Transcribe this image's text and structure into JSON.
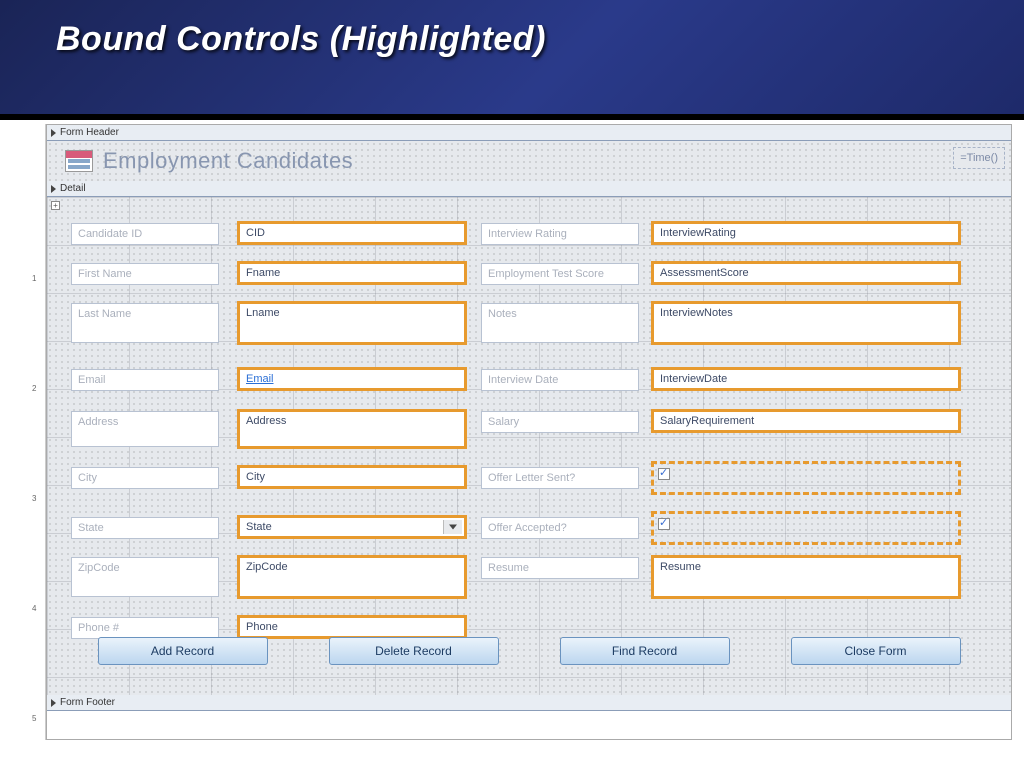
{
  "slide": {
    "title": "Bound Controls (Highlighted)"
  },
  "sections": {
    "header": "Form Header",
    "detail": "Detail",
    "footer": "Form Footer"
  },
  "form": {
    "title": "Employment Candidates",
    "time_expr": "=Time()"
  },
  "labels": {
    "candidate_id": "Candidate ID",
    "first_name": "First Name",
    "last_name": "Last Name",
    "email": "Email",
    "address": "Address",
    "city": "City",
    "state": "State",
    "zipcode": "ZipCode",
    "phone": "Phone #",
    "interview_rating": "Interview Rating",
    "employment_test_score": "Employment Test Score",
    "notes": "Notes",
    "interview_date": "Interview Date",
    "salary": "Salary",
    "offer_letter_sent": "Offer Letter Sent?",
    "offer_accepted": "Offer Accepted?",
    "resume": "Resume"
  },
  "bound": {
    "cid": "CID",
    "fname": "Fname",
    "lname": "Lname",
    "email": "Email",
    "address": "Address",
    "city": "City",
    "state": "State",
    "zipcode": "ZipCode",
    "phone": "Phone",
    "interview_rating": "InterviewRating",
    "assessment_score": "AssessmentScore",
    "interview_notes": "InterviewNotes",
    "interview_date": "InterviewDate",
    "salary_requirement": "SalaryRequirement",
    "resume": "Resume"
  },
  "buttons": {
    "add": "Add Record",
    "delete": "Delete Record",
    "find": "Find Record",
    "close": "Close Form"
  },
  "ruler": {
    "marks": [
      "1",
      "2",
      "3",
      "4",
      "5"
    ]
  }
}
